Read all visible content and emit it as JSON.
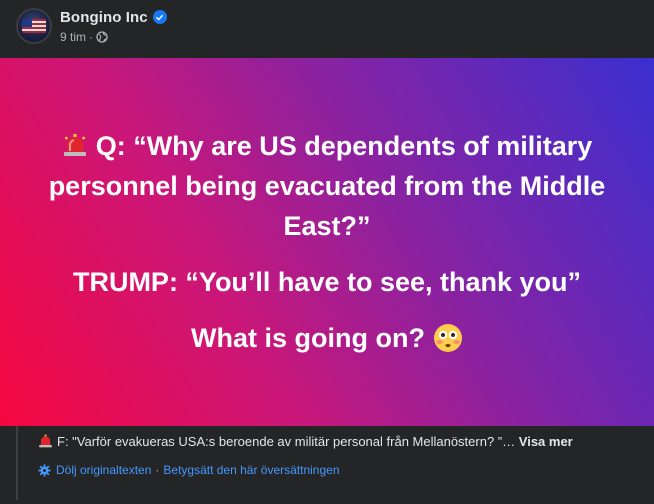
{
  "post": {
    "author": "Bongino Inc",
    "time": "9 tim",
    "separator": "·",
    "audience_icon": "globe-icon",
    "verified_icon": "verified-badge-icon"
  },
  "card": {
    "line_q": "Q: “Why are US dependents of military personnel being evacuated from the Middle East?”",
    "line_trump": "TRUMP: “You’ll have to see, thank you”",
    "line_going": "What is going on?",
    "colors": {
      "gradient_start": "#f5073e",
      "gradient_mid": "#8b22a0",
      "gradient_end": "#3a2fd0"
    }
  },
  "translation": {
    "text": "F: \"Varför evakueras USA:s beroende av militär personal från Mellanöstern? ”…",
    "see_more": "Visa mer",
    "hide_original": "Dölj originaltexten",
    "separator": "·",
    "rate": "Betygsätt den här översättningen"
  },
  "colors": {
    "background": "#242526",
    "link": "#4599ff",
    "verified": "#1877f2"
  }
}
